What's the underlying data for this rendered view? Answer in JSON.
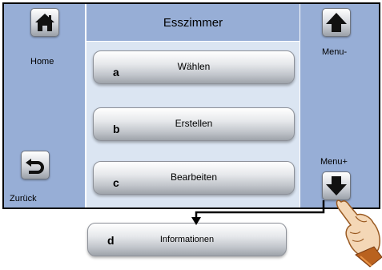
{
  "screen": {
    "title": "Esszimmer"
  },
  "left_panel": {
    "home_label": "Home",
    "back_label": "Zurück"
  },
  "right_panel": {
    "menu_minus_label": "Menu-",
    "menu_plus_label": "Menu+"
  },
  "menu": {
    "items": [
      {
        "letter": "a",
        "label": "Wählen"
      },
      {
        "letter": "b",
        "label": "Erstellen"
      },
      {
        "letter": "c",
        "label": "Bearbeiten"
      }
    ],
    "revealed_item": {
      "letter": "d",
      "label": "Informationen"
    }
  },
  "icons": {
    "home": "house-icon",
    "back": "undo-arrow-icon",
    "up": "arrow-up-icon",
    "down": "arrow-down-icon",
    "pointer": "pointing-hand-icon",
    "connector": "flow-arrow-icon"
  },
  "colors": {
    "side_panel": "#97aed6",
    "center_panel": "#dbe5f2"
  }
}
